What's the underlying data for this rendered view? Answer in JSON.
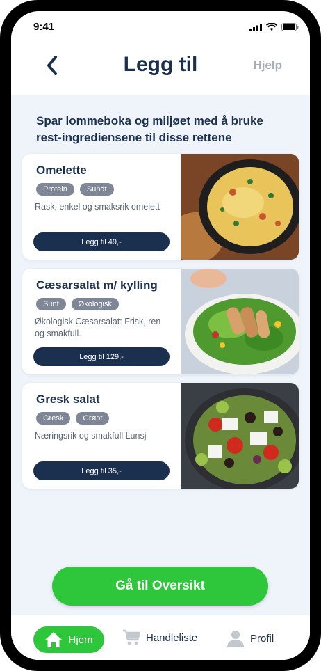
{
  "status_bar": {
    "time": "9:41"
  },
  "header": {
    "title": "Legg til",
    "help": "Hjelp"
  },
  "intro_text": "Spar lommeboka og miljøet med å bruke rest-ingrediensene til disse rettene",
  "recipes": [
    {
      "name": "Omelette",
      "tags": [
        "Protein",
        "Sundt"
      ],
      "description": "Rask, enkel og smaksrik omelett",
      "button": "Legg til 49,-"
    },
    {
      "name": "Cæsarsalat m/ kylling",
      "tags": [
        "Sunt",
        "Økologisk"
      ],
      "description": "Økologisk Cæsarsalat: Frisk, ren og smakfull.",
      "button": "Legg til 129,-"
    },
    {
      "name": "Gresk salat",
      "tags": [
        "Gresk",
        "Grønt"
      ],
      "description": "Næringsrik og smakfull Lunsj",
      "button": "Legg til 35,-"
    }
  ],
  "cta": "Gå til Oversikt",
  "tabbar": {
    "home": "Hjem",
    "list": "Handleliste",
    "profile": "Profil"
  },
  "colors": {
    "navy": "#1b2f4e",
    "green": "#2ec63b",
    "tag_gray": "#7f8696",
    "bg": "#eff3fa"
  }
}
